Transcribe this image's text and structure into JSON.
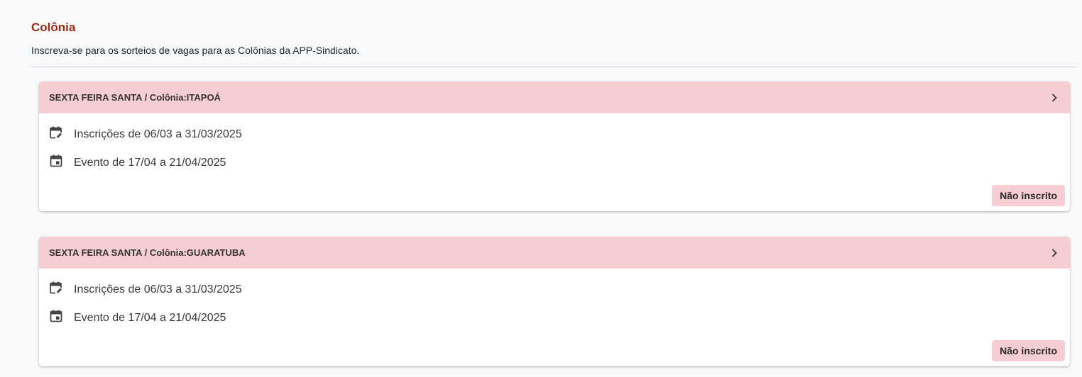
{
  "header": {
    "title": "Colônia",
    "subtitle": "Inscreva-se para os sorteios de vagas para as Colônias da APP-Sindicato."
  },
  "colors": {
    "title": "#9a2a12",
    "card_header_bg": "#f6cdd2",
    "badge_bg": "#f6cdd2",
    "page_bg": "#f8f9fa"
  },
  "cards": [
    {
      "title": "SEXTA FEIRA SANTA / Colônia:ITAPOÁ",
      "registration_icon": "calendar-edit-icon",
      "registration": "Inscrições de 06/03 a 31/03/2025",
      "event_icon": "calendar-event-icon",
      "event": "Evento de 17/04 a 21/04/2025",
      "status": "Não inscrito"
    },
    {
      "title": "SEXTA FEIRA SANTA / Colônia:GUARATUBA",
      "registration_icon": "calendar-edit-icon",
      "registration": "Inscrições de 06/03 a 31/03/2025",
      "event_icon": "calendar-event-icon",
      "event": "Evento de 17/04 a 21/04/2025",
      "status": "Não inscrito"
    }
  ]
}
